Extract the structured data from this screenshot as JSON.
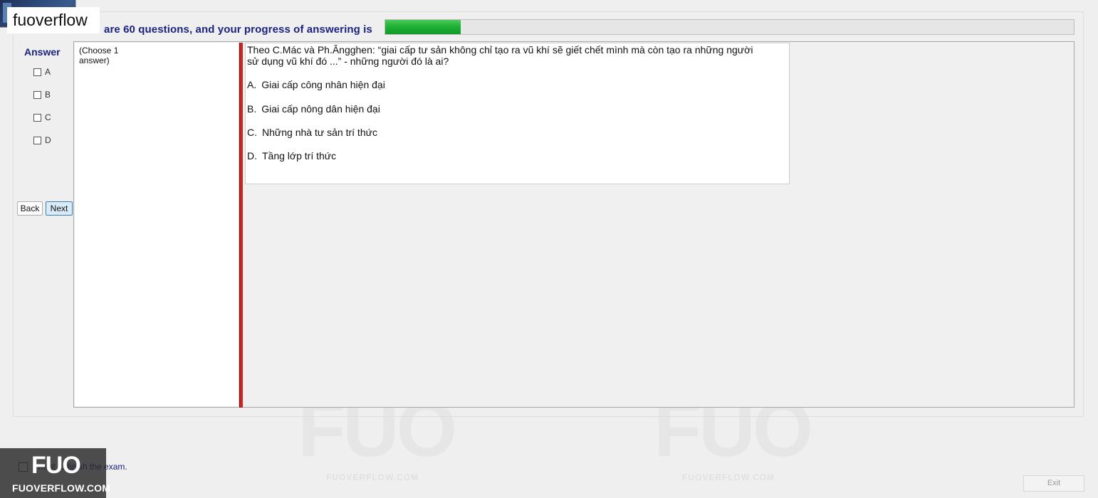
{
  "brand": {
    "label": "fuoverflow"
  },
  "header": {
    "text": "are 60 questions, and your progress of answering is",
    "progress_fraction": 0.11
  },
  "answer_panel": {
    "title": "Answer",
    "choices": [
      "A",
      "B",
      "C",
      "D"
    ],
    "back_label": "Back",
    "next_label": "Next"
  },
  "hint": {
    "text": "(Choose 1 answer)"
  },
  "question": {
    "text": "Theo C.Mác và Ph.Ăngghen: “giai cấp tư sản không chỉ tạo ra vũ khí sẽ giết chết mình mà còn tạo ra những người sử dụng vũ khí đó ...” - những người đó là ai?",
    "options": [
      {
        "letter": "A.",
        "text": "Giai cấp công nhân hiện đại"
      },
      {
        "letter": "B.",
        "text": "Giai cấp nông dân hiện đại"
      },
      {
        "letter": "C.",
        "text": "Những nhà tư sản trí thức"
      },
      {
        "letter": "D.",
        "text": "Tầng lớp trí thức"
      }
    ]
  },
  "footer": {
    "finish_text": "I want to finish the exam.",
    "exit_label": "Exit"
  },
  "watermark": {
    "logo": "FUO",
    "site": "FUOVERFLOW.COM"
  },
  "colors": {
    "header_text": "#1a237e",
    "progress_fill": "#1fb235",
    "splitter": "#c62828"
  }
}
